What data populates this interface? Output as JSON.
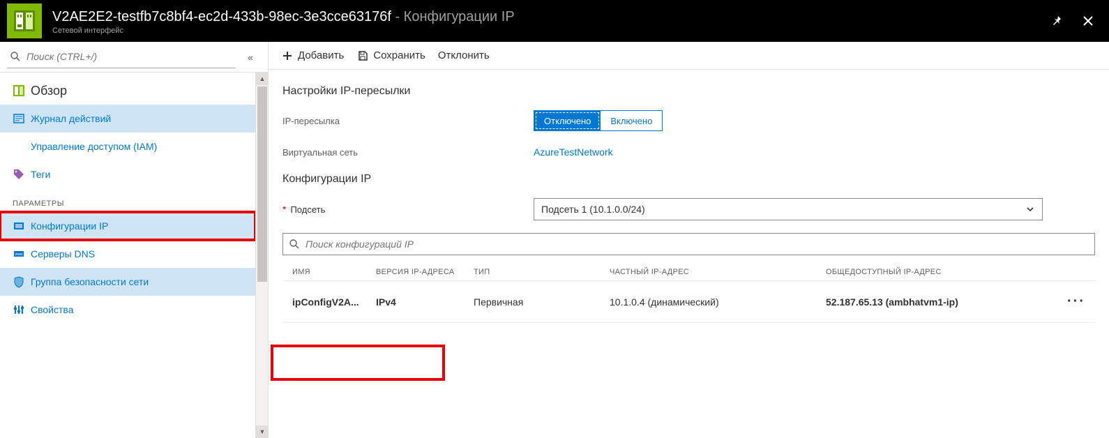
{
  "header": {
    "title_strong": "V2AE2E2-testfb7c8bf4-ec2d-433b-98ec-3e3cce63176f",
    "title_suffix": " - Конфигурации IP",
    "subtitle": "Сетевой интерфейс"
  },
  "sidebar": {
    "search_placeholder": "Поиск (CTRL+/)",
    "items": {
      "overview": "Обзор",
      "activity": "Журнал действий",
      "iam": "Управление доступом (IAM)",
      "tags": "Теги"
    },
    "group_label": "ПАРАМЕТРЫ",
    "settings": {
      "ipcfg": "Конфигурации IP",
      "dns": "Серверы DNS",
      "nsg": "Группа безопасности сети",
      "props": "Свойства"
    }
  },
  "toolbar": {
    "add": "Добавить",
    "save": "Сохранить",
    "discard": "Отклонить"
  },
  "main": {
    "fwd_title": "Настройки IP-пересылки",
    "fwd_label": "IP-пересылка",
    "fwd_off": "Отключено",
    "fwd_on": "Включено",
    "vnet_label": "Виртуальная сеть",
    "vnet_value": "AzureTestNetwork",
    "cfg_title": "Конфигурации IP",
    "subnet_label": "Подсеть",
    "subnet_value": "Подсеть 1 (10.1.0.0/24)",
    "filter_placeholder": "Поиск конфигураций IP"
  },
  "grid": {
    "head": {
      "name": "ИМЯ",
      "ver": "ВЕРСИЯ IP-АДРЕСА",
      "type": "ТИП",
      "priv": "ЧАСТНЫЙ IP-АДРЕС",
      "pub": "ОБЩЕДОСТУПНЫЙ IP-АДРЕС"
    },
    "row": {
      "name": "ipConfigV2A...",
      "ver": "IPv4",
      "type": "Первичная",
      "priv": "10.1.0.4 (динамический)",
      "pub": "52.187.65.13 (ambhatvm1-ip)"
    }
  }
}
